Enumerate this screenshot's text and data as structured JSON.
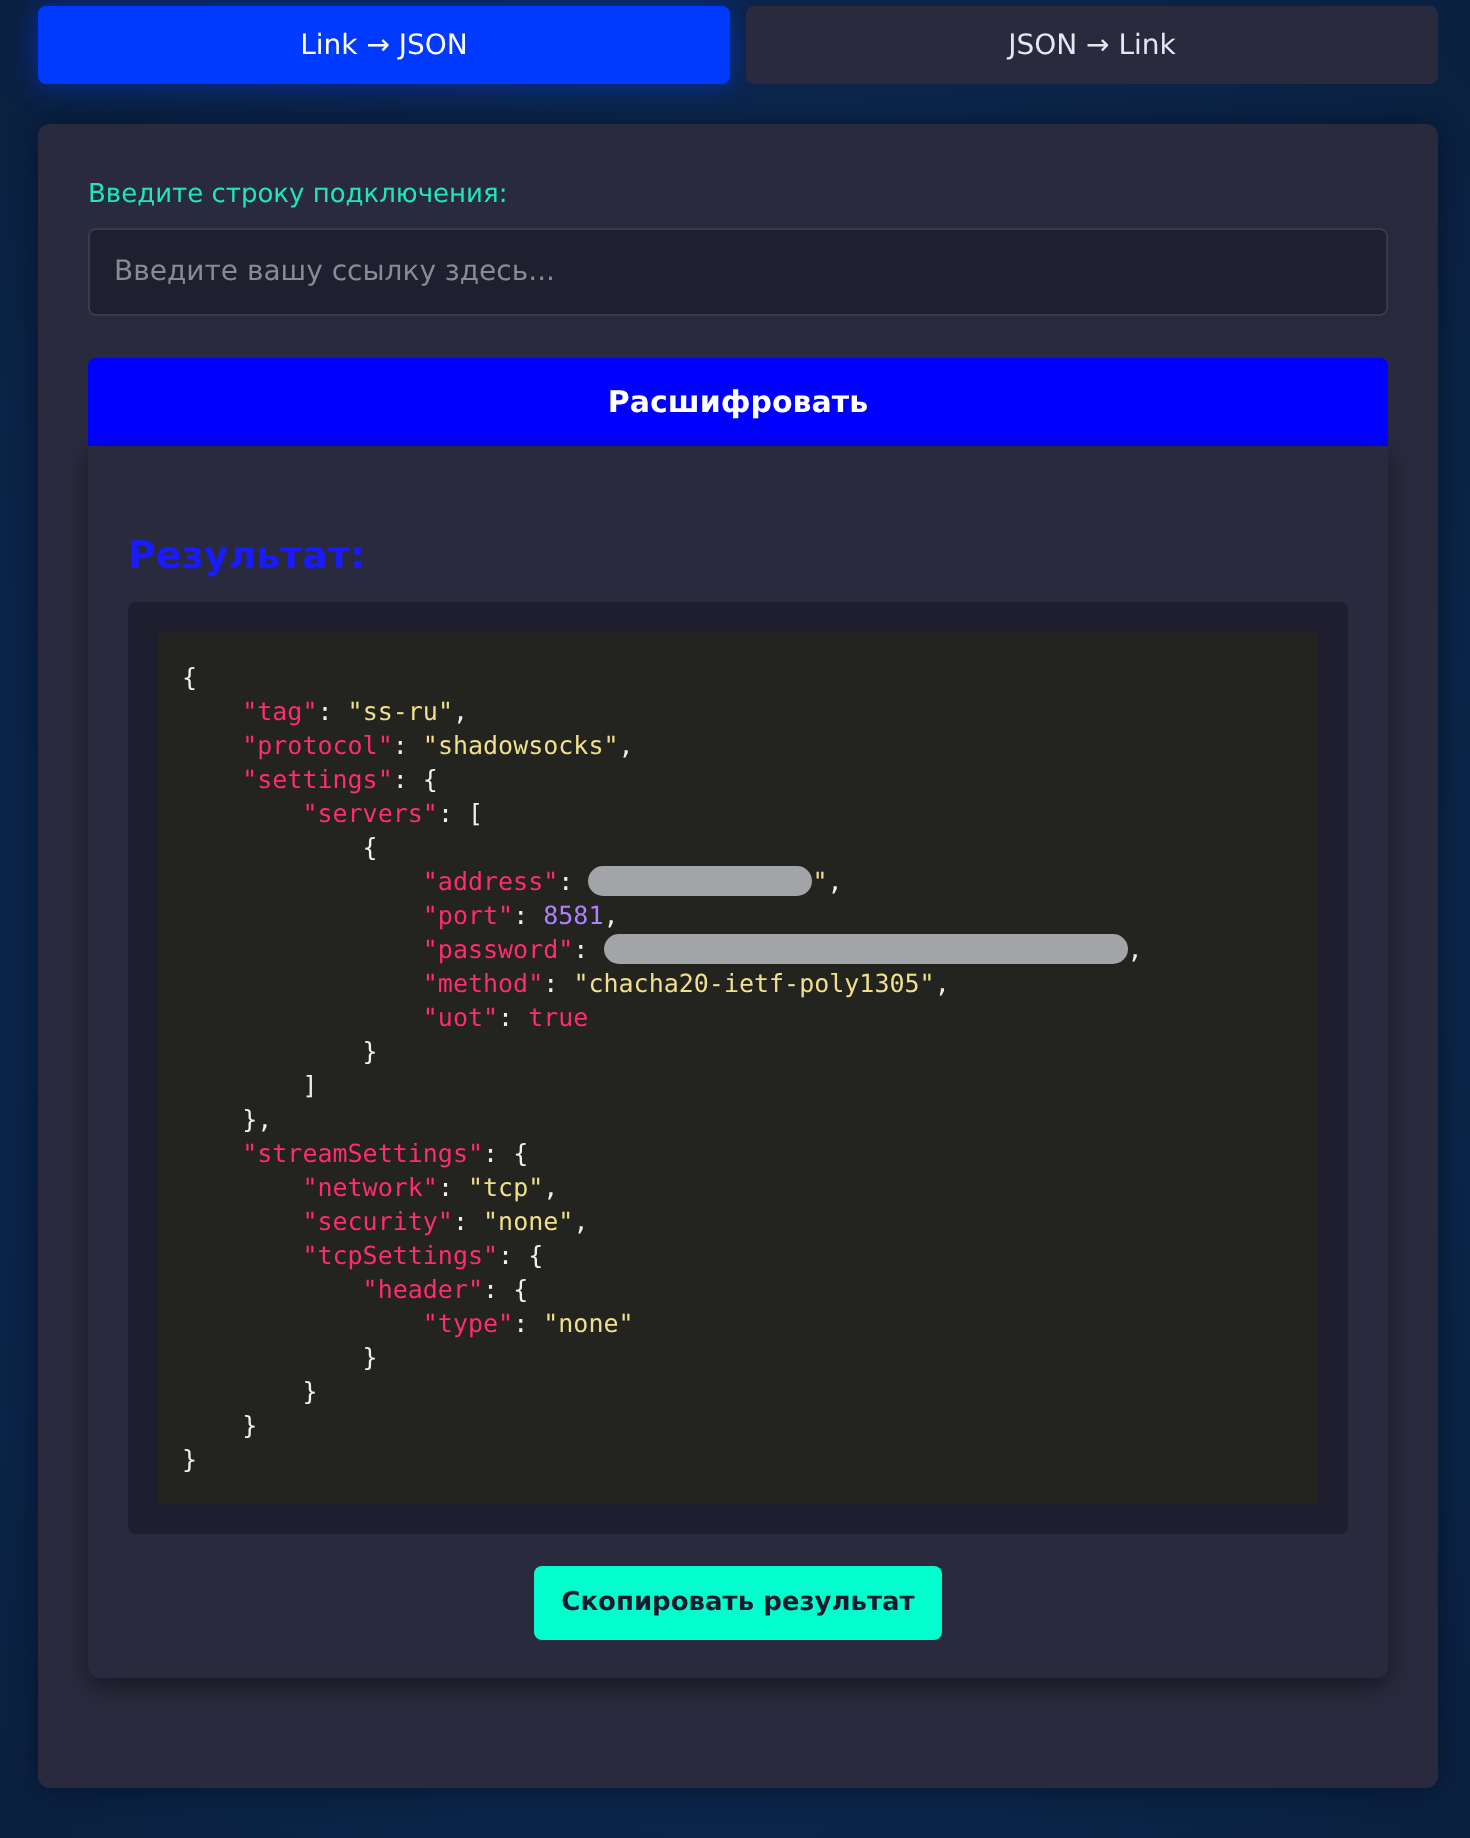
{
  "tabs": [
    {
      "label": "Link → JSON",
      "selected": true
    },
    {
      "label": "JSON → Link",
      "selected": false
    }
  ],
  "input": {
    "label": "Введите строку подключения:",
    "placeholder": "Введите вашу ссылку здесь..."
  },
  "decode_button": "Расшифровать",
  "result": {
    "title": "Результат:",
    "code": [
      {
        "tokens": [
          {
            "kind": "punct",
            "text": "{"
          }
        ],
        "children": [
          {
            "tokens": [
              {
                "kind": "key",
                "text": "\"tag\""
              },
              {
                "kind": "punct",
                "text": ": "
              },
              {
                "kind": "string",
                "text": "\"ss-ru\""
              },
              {
                "kind": "punct",
                "text": ","
              }
            ]
          },
          {
            "tokens": [
              {
                "kind": "key",
                "text": "\"protocol\""
              },
              {
                "kind": "punct",
                "text": ": "
              },
              {
                "kind": "string",
                "text": "\"shadowsocks\""
              },
              {
                "kind": "punct",
                "text": ","
              }
            ]
          },
          {
            "tokens": [
              {
                "kind": "key",
                "text": "\"settings\""
              },
              {
                "kind": "punct",
                "text": ": {"
              }
            ],
            "children": [
              {
                "tokens": [
                  {
                    "kind": "key",
                    "text": "\"servers\""
                  },
                  {
                    "kind": "punct",
                    "text": ": ["
                  }
                ],
                "children": [
                  {
                    "tokens": [
                      {
                        "kind": "punct",
                        "text": "{"
                      }
                    ],
                    "children": [
                      {
                        "tokens": [
                          {
                            "kind": "key",
                            "text": "\"address\""
                          },
                          {
                            "kind": "punct",
                            "text": ": "
                          },
                          {
                            "kind": "redacted"
                          },
                          {
                            "kind": "string",
                            "text": "\""
                          },
                          {
                            "kind": "punct",
                            "text": ","
                          }
                        ]
                      },
                      {
                        "tokens": [
                          {
                            "kind": "key",
                            "text": "\"port\""
                          },
                          {
                            "kind": "punct",
                            "text": ": "
                          },
                          {
                            "kind": "number",
                            "text": "8581"
                          },
                          {
                            "kind": "punct",
                            "text": ","
                          }
                        ]
                      },
                      {
                        "tokens": [
                          {
                            "kind": "key",
                            "text": "\"password\""
                          },
                          {
                            "kind": "punct",
                            "text": ": "
                          },
                          {
                            "kind": "redacted_long"
                          },
                          {
                            "kind": "punct",
                            "text": ","
                          }
                        ]
                      },
                      {
                        "tokens": [
                          {
                            "kind": "key",
                            "text": "\"method\""
                          },
                          {
                            "kind": "punct",
                            "text": ": "
                          },
                          {
                            "kind": "string",
                            "text": "\"chacha20-ietf-poly1305\""
                          },
                          {
                            "kind": "punct",
                            "text": ","
                          }
                        ]
                      },
                      {
                        "tokens": [
                          {
                            "kind": "key",
                            "text": "\"uot\""
                          },
                          {
                            "kind": "punct",
                            "text": ": "
                          },
                          {
                            "kind": "literal",
                            "text": "true"
                          }
                        ]
                      }
                    ],
                    "end": [
                      {
                        "kind": "punct",
                        "text": "}"
                      }
                    ]
                  }
                ],
                "end": [
                  {
                    "kind": "punct",
                    "text": "]"
                  }
                ]
              }
            ],
            "end": [
              {
                "kind": "punct",
                "text": "},"
              }
            ]
          },
          {
            "tokens": [
              {
                "kind": "key",
                "text": "\"streamSettings\""
              },
              {
                "kind": "punct",
                "text": ": {"
              }
            ],
            "children": [
              {
                "tokens": [
                  {
                    "kind": "key",
                    "text": "\"network\""
                  },
                  {
                    "kind": "punct",
                    "text": ": "
                  },
                  {
                    "kind": "string",
                    "text": "\"tcp\""
                  },
                  {
                    "kind": "punct",
                    "text": ","
                  }
                ]
              },
              {
                "tokens": [
                  {
                    "kind": "key",
                    "text": "\"security\""
                  },
                  {
                    "kind": "punct",
                    "text": ": "
                  },
                  {
                    "kind": "string",
                    "text": "\"none\""
                  },
                  {
                    "kind": "punct",
                    "text": ","
                  }
                ]
              },
              {
                "tokens": [
                  {
                    "kind": "key",
                    "text": "\"tcpSettings\""
                  },
                  {
                    "kind": "punct",
                    "text": ": {"
                  }
                ],
                "children": [
                  {
                    "tokens": [
                      {
                        "kind": "key",
                        "text": "\"header\""
                      },
                      {
                        "kind": "punct",
                        "text": ": {"
                      }
                    ],
                    "children": [
                      {
                        "tokens": [
                          {
                            "kind": "key",
                            "text": "\"type\""
                          },
                          {
                            "kind": "punct",
                            "text": ": "
                          },
                          {
                            "kind": "string",
                            "text": "\"none\""
                          }
                        ]
                      }
                    ],
                    "end": [
                      {
                        "kind": "punct",
                        "text": "}"
                      }
                    ]
                  }
                ],
                "end": [
                  {
                    "kind": "punct",
                    "text": "}"
                  }
                ]
              }
            ],
            "end": [
              {
                "kind": "punct",
                "text": "}"
              }
            ]
          }
        ],
        "end": [
          {
            "kind": "punct",
            "text": "}"
          }
        ]
      }
    ],
    "copy_button": "Скопировать результат"
  }
}
